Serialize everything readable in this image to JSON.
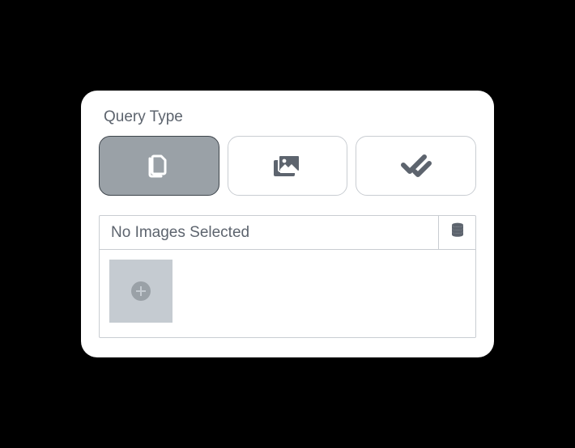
{
  "query_type": {
    "title": "Query Type",
    "options": [
      {
        "id": "by-document",
        "icon": "documents-icon",
        "selected": true
      },
      {
        "id": "by-image",
        "icon": "images-icon",
        "selected": false
      },
      {
        "id": "by-check",
        "icon": "double-check-icon",
        "selected": false
      }
    ]
  },
  "images_panel": {
    "title": "No Images Selected",
    "header_action_icon": "database-icon",
    "tiles": []
  }
}
